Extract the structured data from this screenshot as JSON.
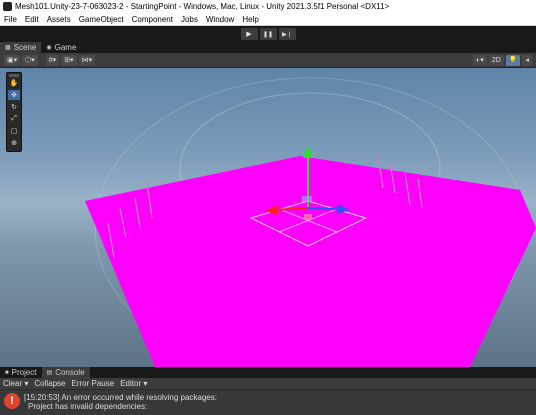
{
  "window": {
    "title": "Mesh101.Unity-23-7-063023-2 - StartingPoint - Windows, Mac, Linux - Unity 2021.3.5f1 Personal <DX11>"
  },
  "menu": [
    "File",
    "Edit",
    "Assets",
    "GameObject",
    "Component",
    "Jobs",
    "Window",
    "Help"
  ],
  "play_controls": {
    "play": "▶",
    "pause": "❚❚",
    "step": "▶❘"
  },
  "tabs": [
    {
      "label": "Scene",
      "icon": "scene-icon",
      "active": true
    },
    {
      "label": "Game",
      "icon": "game-icon",
      "active": false
    }
  ],
  "scene_toolbar": {
    "mode_2d": "2D"
  },
  "tools": [
    "hand-tool",
    "move-tool",
    "rotate-tool",
    "scale-tool",
    "rect-tool",
    "transform-tool"
  ],
  "bottom_tabs": [
    {
      "label": "Project",
      "icon": "folder-icon",
      "active": false
    },
    {
      "label": "Console",
      "icon": "console-icon",
      "active": true
    }
  ],
  "console_toolbar": {
    "clear": "Clear",
    "collapse": "Collapse",
    "error_pause": "Error Pause",
    "editor": "Editor"
  },
  "console": {
    "error_line1": "[15:20:53] An error occurred while resolving packages:",
    "error_line2": "Project has invalid dependencies:"
  },
  "colors": {
    "mesh": "#ff00ff",
    "gizmo_x": "#ff2020",
    "gizmo_y": "#30e030",
    "gizmo_z": "#3050ff",
    "error": "#e0442e"
  }
}
